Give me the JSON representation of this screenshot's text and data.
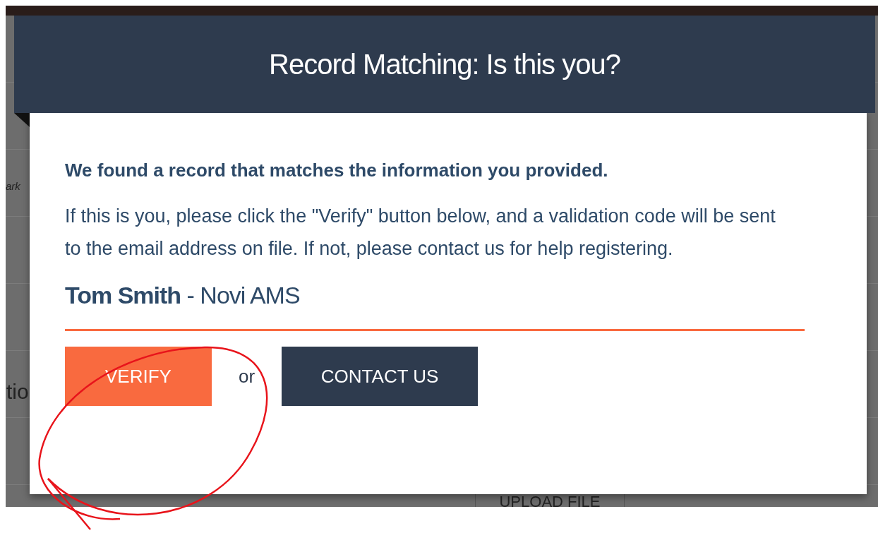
{
  "backdrop": {
    "fragments": [
      {
        "text": "ark",
        "kind": "small"
      },
      {
        "text": "tio",
        "kind": "heading"
      }
    ],
    "button": "UPLOAD FILE"
  },
  "modal": {
    "title": "Record Matching: Is this you?",
    "lead": "We found a record that matches the information you provided.",
    "message": "If this is you, please click the \"Verify\" button below, and a validation code will be sent to the email address on file. If not, please contact us for help registering.",
    "record": "**Tom Smith** - Novi AMS",
    "actions": [
      {
        "label": "VERIFY",
        "kind": "primary"
      },
      {
        "label": "or",
        "kind": "separator"
      },
      {
        "label": "CONTACT US",
        "kind": "secondary"
      }
    ]
  }
}
